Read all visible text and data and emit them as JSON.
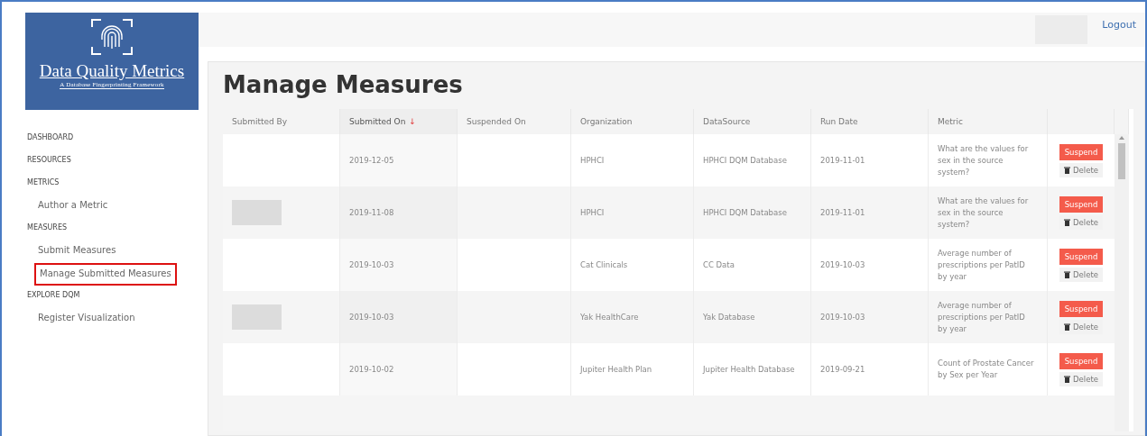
{
  "logo": {
    "title": "Data Quality Metrics",
    "subtitle": "A Database Fingerprinting Framework"
  },
  "sidebar": {
    "items": [
      {
        "label": "DASHBOARD",
        "kind": "heading",
        "selected": false
      },
      {
        "label": "RESOURCES",
        "kind": "heading",
        "selected": false
      },
      {
        "label": "METRICS",
        "kind": "heading",
        "selected": false
      },
      {
        "label": "Author a Metric",
        "kind": "link",
        "selected": false
      },
      {
        "label": "MEASURES",
        "kind": "heading",
        "selected": false
      },
      {
        "label": "Submit Measures",
        "kind": "link",
        "selected": false
      },
      {
        "label": "Manage Submitted Measures",
        "kind": "link",
        "selected": true
      },
      {
        "label": "EXPLORE DQM",
        "kind": "heading",
        "selected": false
      },
      {
        "label": "Register Visualization",
        "kind": "link",
        "selected": false
      }
    ]
  },
  "header": {
    "logout": "Logout"
  },
  "page": {
    "title": "Manage Measures"
  },
  "table": {
    "columns": [
      {
        "label": "Submitted By",
        "sorted": false
      },
      {
        "label": "Submitted On",
        "sorted": true,
        "sort_icon": "↓"
      },
      {
        "label": "Suspended On",
        "sorted": false
      },
      {
        "label": "Organization",
        "sorted": false
      },
      {
        "label": "DataSource",
        "sorted": false
      },
      {
        "label": "Run Date",
        "sorted": false
      },
      {
        "label": "Metric",
        "sorted": false
      }
    ],
    "rows": [
      {
        "redacted": false,
        "submitted_on": "2019-12-05",
        "organization": "HPHCI",
        "datasource": "HPHCI DQM Database",
        "run_date": "2019-11-01",
        "metric": "What are the values for sex in the source system?",
        "suspend": "Suspend",
        "delete": "Delete"
      },
      {
        "redacted": true,
        "submitted_on": "2019-11-08",
        "organization": "HPHCI",
        "datasource": "HPHCI DQM Database",
        "run_date": "2019-11-01",
        "metric": "What are the values for sex in the source system?",
        "suspend": "Suspend",
        "delete": "Delete"
      },
      {
        "redacted": false,
        "submitted_on": "2019-10-03",
        "organization": "Cat Clinicals",
        "datasource": "CC Data",
        "run_date": "2019-10-03",
        "metric": "Average number of prescriptions per PatID by year",
        "suspend": "Suspend",
        "delete": "Delete"
      },
      {
        "redacted": true,
        "submitted_on": "2019-10-03",
        "organization": "Yak HealthCare",
        "datasource": "Yak Database",
        "run_date": "2019-10-03",
        "metric": "Average number of prescriptions per PatID by year",
        "suspend": "Suspend",
        "delete": "Delete"
      },
      {
        "redacted": false,
        "submitted_on": "2019-10-02",
        "organization": "Jupiter Health Plan",
        "datasource": "Jupiter Health Database",
        "run_date": "2019-09-21",
        "metric": "Count of Prostate Cancer by Sex per Year",
        "suspend": "Suspend",
        "delete": "Delete"
      }
    ]
  }
}
